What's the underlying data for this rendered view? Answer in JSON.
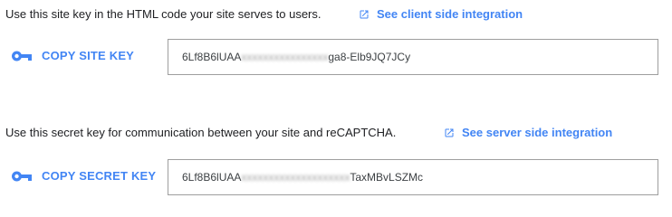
{
  "site_key_section": {
    "description": "Use this site key in the HTML code your site serves to users.",
    "link_label": "See client side integration",
    "copy_label": "COPY SITE KEY",
    "key_prefix": "6Lf8B6lUAA",
    "key_suffix": "ga8-Elb9JQ7JCy"
  },
  "secret_key_section": {
    "description": "Use this secret key for communication between your site and reCAPTCHA.",
    "link_label": "See server side integration",
    "copy_label": "COPY SECRET KEY",
    "key_prefix": "6Lf8B6lUAA",
    "key_suffix": "TaxMBvLSZMc"
  },
  "colors": {
    "link": "#4285f4",
    "text": "#202124",
    "field_border": "#9e9e9e"
  },
  "icons": {
    "external_link": "open-in-new-icon",
    "key": "vpn-key-icon"
  }
}
